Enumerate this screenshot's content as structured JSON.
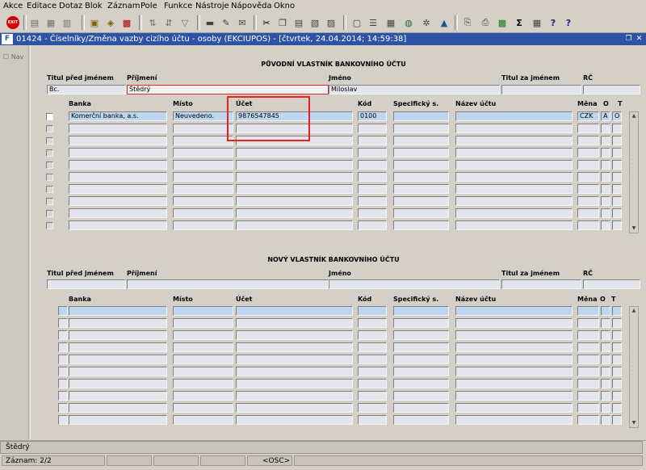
{
  "menu": [
    "Akce",
    "Editace",
    "Dotaz",
    "Blok",
    "Záznam",
    "Pole",
    "Funkce",
    "Nástroje",
    "Nápověda",
    "Okno"
  ],
  "toolbar": {
    "exit_label": "EXIT",
    "icons": [
      "save-icon",
      "new-record-icon",
      "delete-record-icon",
      "clear-icon",
      "enter-query-icon",
      "execute-query-icon",
      "cancel-query-icon",
      "sort-asc-icon",
      "sort-desc-icon",
      "filter-icon",
      "print-icon",
      "edit-icon",
      "mail-icon",
      "cut-icon",
      "copy-icon",
      "paste-icon",
      "tools-icon",
      "report-icon",
      "globe-icon",
      "settings-icon",
      "triangle-icon",
      "export-icon",
      "excel-icon",
      "sum-icon",
      "help-icon",
      "context-help-icon"
    ]
  },
  "window": {
    "title": "01424 - Číselníky/Změna vazby cizího účtu - osoby (EKCIUPOS) - [čtvrtek, 24.04.2014; 14:59:38]",
    "nav_label": "Nav"
  },
  "original": {
    "header": "PŮVODNÍ VLASTNÍK BANKOVNÍHO ÚČTU",
    "labels": {
      "title_before": "Titul před jménem",
      "surname": "Příjmení",
      "first_name": "Jméno",
      "title_after": "Titul za jménem",
      "rc": "RČ"
    },
    "values": {
      "title_before": "Bc.",
      "surname": "Štědrý",
      "first_name": "Miloslav",
      "title_after": "",
      "rc": ""
    },
    "columns": {
      "bank": "Banka",
      "place": "Místo",
      "account": "Účet",
      "code": "Kód",
      "specific": "Specifický s.",
      "account_name": "Název účtu",
      "currency": "Měna",
      "o": "O",
      "t": "T"
    },
    "rows": [
      {
        "bank": "Komerční banka, a.s.",
        "place": "Neuvedeno.",
        "account": "9876547845",
        "code": "0100",
        "specific": "",
        "account_name": "",
        "currency": "CZK",
        "o": "A",
        "t": "O"
      }
    ]
  },
  "new": {
    "header": "NOVÝ VLASTNÍK BANKOVNÍHO ÚČTU",
    "labels": {
      "title_before": "Titul před jménem",
      "surname": "Příjmení",
      "first_name": "Jméno",
      "title_after": "Titul za jménem",
      "rc": "RČ"
    },
    "columns": {
      "bank": "Banka",
      "place": "Místo",
      "account": "Účet",
      "code": "Kód",
      "specific": "Specifický s.",
      "account_name": "Název účtu",
      "currency": "Měna",
      "o": "O",
      "t": "T"
    }
  },
  "status": {
    "message": "Štědrý",
    "record": "Záznam: 2/2",
    "mode": "<OSC>"
  },
  "colors": {
    "titlebar": "#2e53a4",
    "current_row": "#bfd6f0",
    "highlight": "#e82020"
  }
}
